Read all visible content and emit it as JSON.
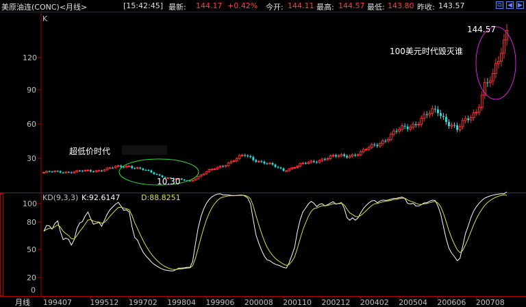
{
  "header": {
    "instrument": "美原油连(CONC)<月线>",
    "time": "[15:42:45]",
    "latest_label": "最新:",
    "latest_value": "144.17",
    "change": "+0.42%",
    "open_label": "今开:",
    "open_value": "144.11",
    "high_label": "最高:",
    "high_value": "144.57",
    "low_label": "最低:",
    "low_value": "143.80",
    "prevclose_label": "昨收:",
    "prevclose_value": "143.57"
  },
  "window_buttons": [
    "restore-icon",
    "arrow-left-icon",
    "arrow-right-icon"
  ],
  "colors": {
    "up": "#ff3030",
    "down": "#30e0e0",
    "axis": "#b00000",
    "k_line": "#ffffff",
    "d_line": "#e0e040"
  },
  "main_panel": {
    "label": "K",
    "y_ticks": [
      "120",
      "90",
      "60",
      "30"
    ],
    "annotations": {
      "low_note": "超低价时代",
      "low_value": "10.30",
      "high_note": "100美元时代毁灭谁",
      "high_value": "144.57"
    }
  },
  "kd_panel": {
    "label": "KD(9,3,3)",
    "k_text": "K:92.6147",
    "d_text": "D:88.8251",
    "y_ticks": [
      "100",
      "80",
      "50",
      "20",
      "0"
    ]
  },
  "x_axis": {
    "label": "月线",
    "ticks": [
      "199407",
      "199512",
      "199702",
      "199804",
      "199906",
      "200008",
      "200110",
      "200212",
      "200402",
      "200504",
      "200606",
      "200708"
    ]
  },
  "chart_data": {
    "type": "candlestick",
    "title": "美原油连(CONC)<月线>",
    "ylim": [
      0,
      150
    ],
    "x_range": [
      "199407",
      "200807"
    ],
    "price_path": [
      [
        "199407",
        18
      ],
      [
        "199512",
        19
      ],
      [
        "199702",
        24
      ],
      [
        "199804",
        13
      ],
      [
        "199812",
        10.3
      ],
      [
        "199906",
        18
      ],
      [
        "200008",
        33
      ],
      [
        "200110",
        20
      ],
      [
        "200212",
        30
      ],
      [
        "200402",
        35
      ],
      [
        "200504",
        55
      ],
      [
        "200606",
        73
      ],
      [
        "200701",
        55
      ],
      [
        "200708",
        74
      ],
      [
        "200711",
        95
      ],
      [
        "200802",
        100
      ],
      [
        "200807",
        144.57
      ]
    ],
    "kd_series": [
      {
        "name": "K",
        "last": 92.6147
      },
      {
        "name": "D",
        "last": 88.8251
      }
    ]
  }
}
